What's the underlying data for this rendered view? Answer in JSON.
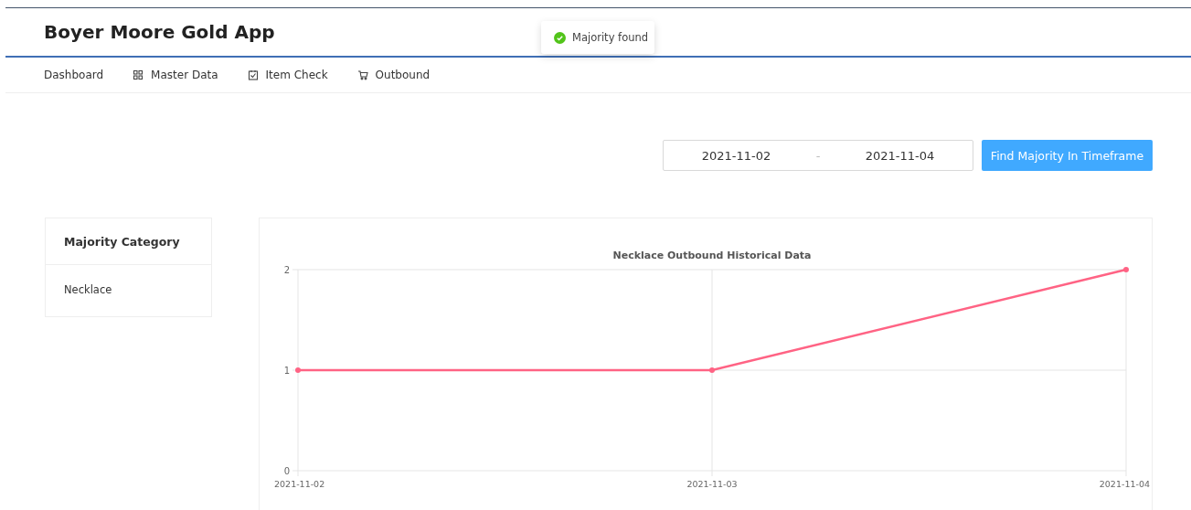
{
  "app": {
    "title": "Boyer Moore Gold App"
  },
  "toast": {
    "text": "Majority found"
  },
  "nav": [
    {
      "label": "Dashboard",
      "kind": "plain"
    },
    {
      "label": "Master Data",
      "kind": "grid"
    },
    {
      "label": "Item Check",
      "kind": "check"
    },
    {
      "label": "Outbound",
      "kind": "cart"
    }
  ],
  "date_range": {
    "start": "2021-11-02",
    "separator": "-",
    "end": "2021-11-04"
  },
  "find_button": "Find Majority In Timeframe",
  "majority_card": {
    "title": "Majority Category",
    "value": "Necklace"
  },
  "chart": {
    "chart_data": {
      "type": "line",
      "title": "Necklace Outbound Historical Data",
      "categories": [
        "2021-11-02",
        "2021-11-03",
        "2021-11-04"
      ],
      "series": [
        {
          "color": "#ff6384",
          "marker": true,
          "values": [
            1,
            1,
            2
          ]
        }
      ],
      "ylim": [
        0,
        2
      ],
      "yticks": [
        0,
        1,
        2
      ],
      "grid": true
    }
  }
}
